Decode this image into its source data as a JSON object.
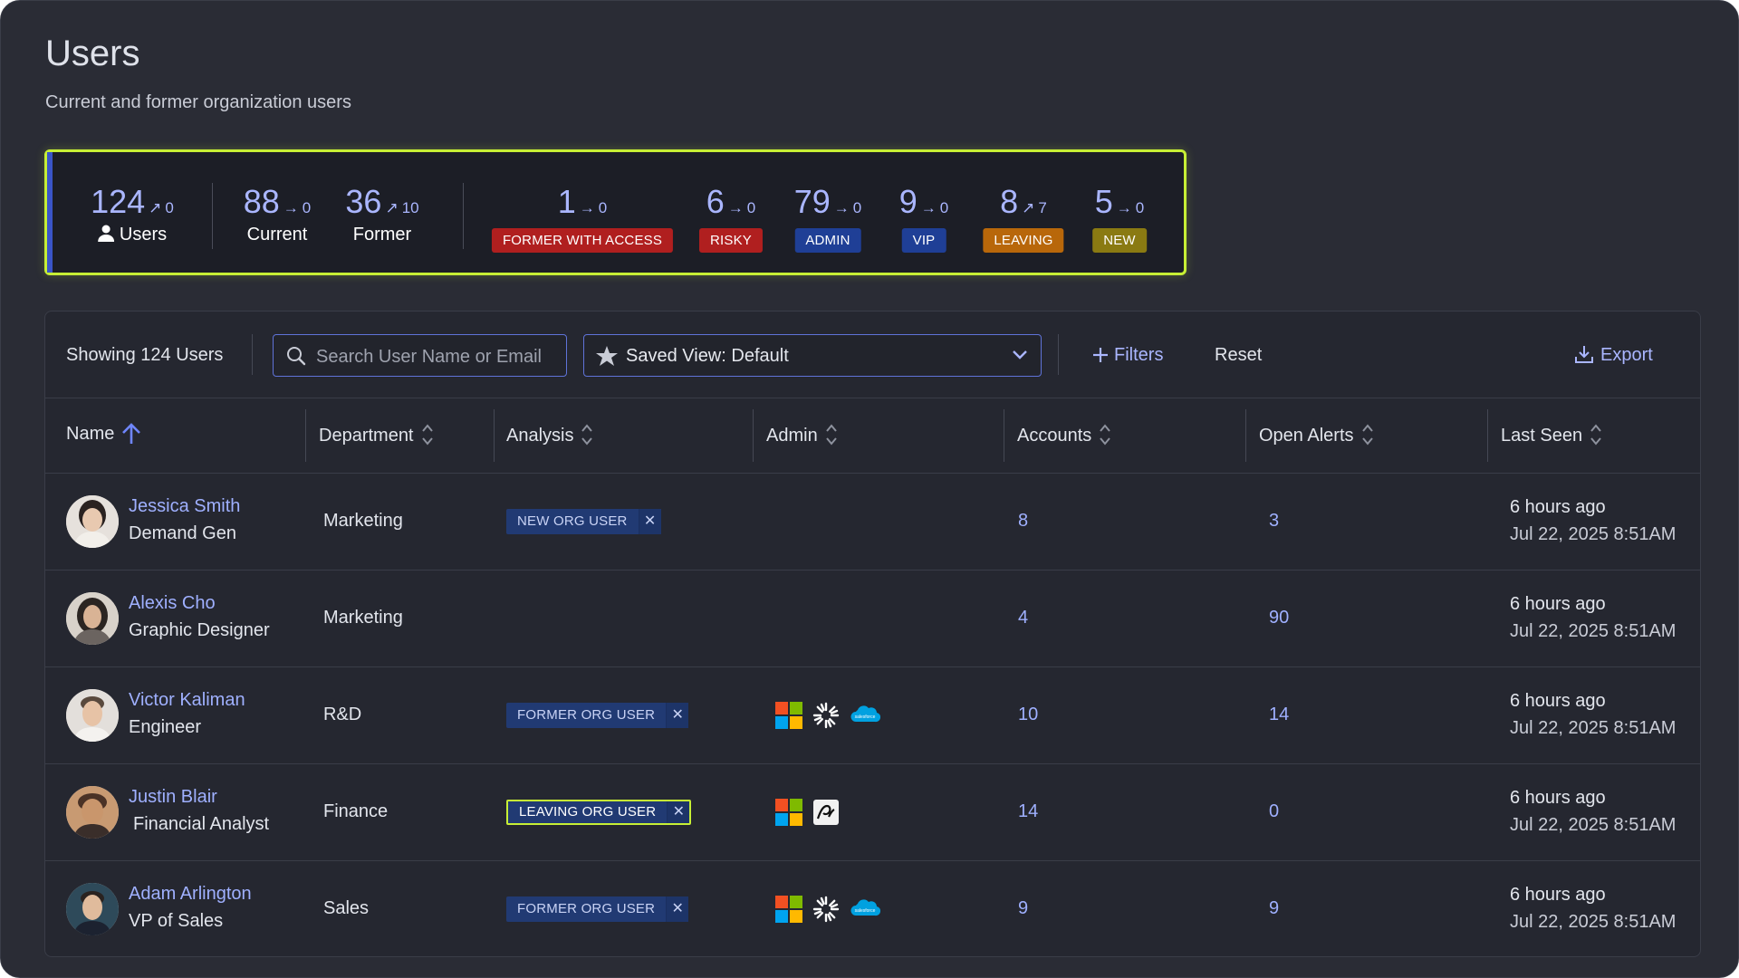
{
  "header": {
    "title": "Users",
    "subtitle": "Current and former organization users"
  },
  "stats": {
    "total": {
      "value": "124",
      "trend": "0",
      "label": "Users"
    },
    "current": {
      "value": "88",
      "trend": "0",
      "label": "Current"
    },
    "former": {
      "value": "36",
      "trend": "10",
      "label": "Former"
    },
    "badges": [
      {
        "value": "1",
        "trend": "0",
        "label": "FORMER WITH ACCESS",
        "color": "#b01f1f"
      },
      {
        "value": "6",
        "trend": "0",
        "label": "RISKY",
        "color": "#b01f1f"
      },
      {
        "value": "79",
        "trend": "0",
        "label": "ADMIN",
        "color": "#1f3f96"
      },
      {
        "value": "9",
        "trend": "0",
        "label": "VIP",
        "color": "#1f3f96"
      },
      {
        "value": "8",
        "trend": "7",
        "label": "LEAVING",
        "color": "#b8670a"
      },
      {
        "value": "5",
        "trend": "0",
        "label": "NEW",
        "color": "#8a7a12"
      }
    ]
  },
  "toolbar": {
    "showing": "Showing 124 Users",
    "search_placeholder": "Search User Name or Email",
    "saved_view_label": "Saved View:",
    "saved_view_value": "Default",
    "filters_label": "Filters",
    "reset_label": "Reset",
    "export_label": "Export"
  },
  "columns": [
    "Name",
    "Department",
    "Analysis",
    "Admin",
    "Accounts",
    "Open Alerts",
    "Last Seen"
  ],
  "rows": [
    {
      "name": "Jessica Smith",
      "title": "Demand Gen",
      "department": "Marketing",
      "analysis": "NEW ORG USER",
      "admin_icons": [],
      "accounts": "8",
      "open_alerts": "3",
      "last_seen_relative": "6 hours ago",
      "last_seen_date": "Jul 22, 2025 8:51AM"
    },
    {
      "name": "Alexis Cho",
      "title": "Graphic Designer",
      "department": "Marketing",
      "analysis": "",
      "admin_icons": [],
      "accounts": "4",
      "open_alerts": "90",
      "last_seen_relative": "6 hours ago",
      "last_seen_date": "Jul 22, 2025 8:51AM"
    },
    {
      "name": "Victor Kaliman",
      "title": "Engineer",
      "department": "R&D",
      "analysis": "FORMER ORG USER",
      "admin_icons": [
        "microsoft-icon",
        "sunburst-icon",
        "salesforce-icon"
      ],
      "accounts": "10",
      "open_alerts": "14",
      "last_seen_relative": "6 hours ago",
      "last_seen_date": "Jul 22, 2025 8:51AM"
    },
    {
      "name": "Justin Blair",
      "title": "Financial Analyst",
      "department": "Finance",
      "analysis": "LEAVING ORG USER",
      "admin_icons": [
        "microsoft-icon",
        "app-icon"
      ],
      "accounts": "14",
      "open_alerts": "0",
      "last_seen_relative": "6 hours ago",
      "last_seen_date": "Jul 22, 2025 8:51AM"
    },
    {
      "name": "Adam Arlington",
      "title": "VP of Sales",
      "department": "Sales",
      "analysis": "FORMER ORG USER",
      "admin_icons": [
        "microsoft-icon",
        "sunburst-icon",
        "salesforce-icon"
      ],
      "accounts": "9",
      "open_alerts": "9",
      "last_seen_relative": "6 hours ago",
      "last_seen_date": "Jul 22, 2025 8:51AM"
    }
  ],
  "salesforce_logo_text": "salesforce",
  "colors": {
    "accent": "#9fb0ff",
    "highlight": "#c7ef35",
    "background": "#2a2c35",
    "card": "#1c1e26"
  }
}
